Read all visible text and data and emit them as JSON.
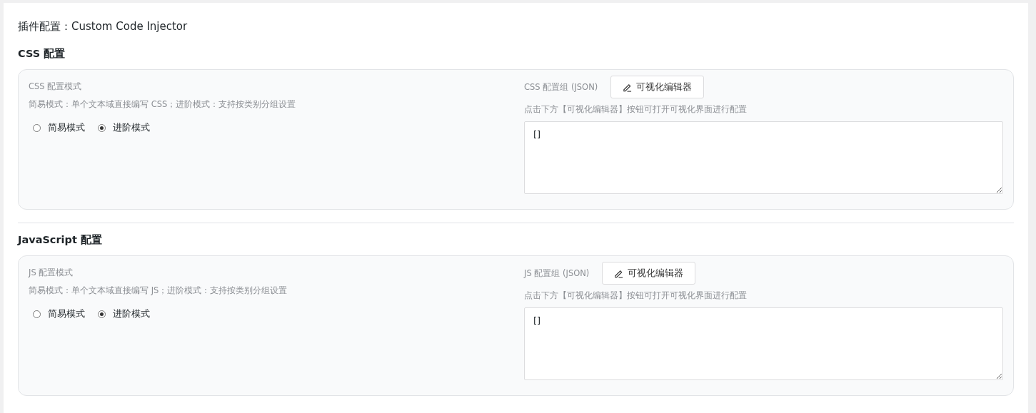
{
  "title": "插件配置：Custom Code Injector",
  "sections": [
    {
      "heading": "CSS 配置",
      "mode_label": "CSS 配置模式",
      "mode_hint": "简易模式：单个文本域直接编写 CSS；进阶模式：支持按类别分组设置",
      "modes": [
        {
          "label": "简易模式",
          "selected": false
        },
        {
          "label": "进阶模式",
          "selected": true
        }
      ],
      "group_label": "CSS 配置组 (JSON)",
      "editor_button": "可视化编辑器",
      "group_hint": "点击下方【可视化编辑器】按钮可打开可视化界面进行配置",
      "value": "[]"
    },
    {
      "heading": "JavaScript 配置",
      "mode_label": "JS 配置模式",
      "mode_hint": "简易模式：单个文本域直接编写 JS；进阶模式：支持按类别分组设置",
      "modes": [
        {
          "label": "简易模式",
          "selected": false
        },
        {
          "label": "进阶模式",
          "selected": true
        }
      ],
      "group_label": "JS 配置组 (JSON)",
      "editor_button": "可视化编辑器",
      "group_hint": "点击下方【可视化编辑器】按钮可打开可视化界面进行配置",
      "value": "[]"
    }
  ]
}
